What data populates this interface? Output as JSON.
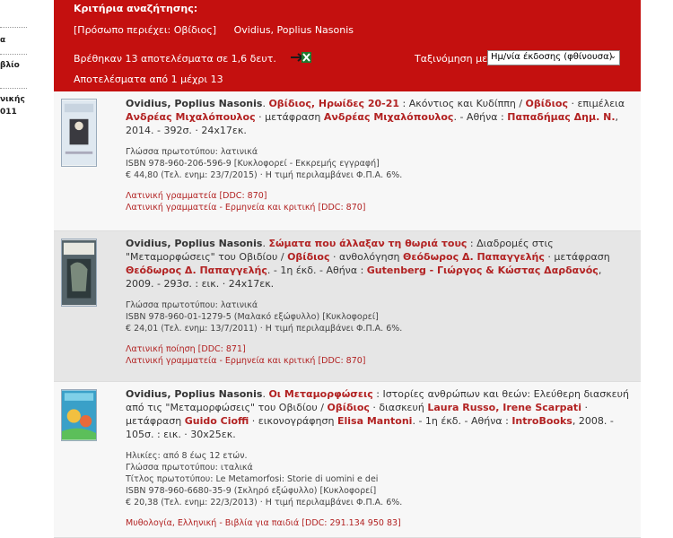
{
  "left_fragments": [
    "α",
    "βλίο",
    "νικής",
    "011"
  ],
  "header": {
    "title": "Κριτήρια αναζήτησης:",
    "criteria_person": "[Πρόσωπο περιέχει: Οβίδιος]",
    "criteria_name": "Ovidius, Poplius Nasonis",
    "found_text": "Βρέθηκαν 13 αποτελέσματα σε 1,6 δευτ.",
    "range_text": "Αποτελέσματα από 1 μέχρι 13",
    "sort_label": "Ταξινόμηση με",
    "sort_value": "Ημ/νία έκδοσης (φθίνουσα)"
  },
  "results": [
    {
      "author": "Ovidius, Poplius Nasonis",
      "title": "Οβίδιος, Ηρωίδες 20-21",
      "subtitle": " : Ακόντιος και Κυδίππη / ",
      "author2": "Οβίδιος",
      "roles": " · επιμέλεια ",
      "editor": "Ανδρέας Μιχαλόπουλος",
      "roles2": " · μετάφραση ",
      "translator": "Ανδρέας Μιχαλόπουλος",
      "place": ". - Αθήνα : ",
      "publisher": "Παπαδήμας Δημ. Ν.",
      "tail": ", 2014. - 392σ. · 24x17εκ.",
      "language": "Γλώσσα πρωτοτύπου: λατινικά",
      "isbn": "ISBN 978-960-206-596-9 [Κυκλοφορεί - Εκκρεμής εγγραφή]",
      "price": "€ 44,80 (Τελ. ενημ: 23/7/2015) · Η τιμή περιλαμβάνει Φ.Π.Α. 6%.",
      "subjects": [
        "Λατινική γραμματεία [DDC: 870]",
        "Λατινική γραμματεία - Ερμηνεία και κριτική [DDC: 870]"
      ]
    },
    {
      "author": "Ovidius, Poplius Nasonis",
      "title": "Σώματα που άλλαξαν τη θωριά τους",
      "subtitle": " : Διαδρομές στις \"Μεταμορφώσεις\" του Οβιδίου / ",
      "author2": "Οβίδιος",
      "roles": " · ανθολόγηση ",
      "editor": "Θεόδωρος Δ. Παπαγγελής",
      "roles2": " · μετάφραση ",
      "translator": "Θεόδωρος Δ. Παπαγγελής",
      "place": ". - 1η έκδ. - Αθήνα : ",
      "publisher": "Gutenberg - Γιώργος & Κώστας Δαρδανός",
      "tail": ", 2009. - 293σ. : εικ. · 24x17εκ.",
      "language": "Γλώσσα πρωτοτύπου: λατινικά",
      "isbn": "ISBN 978-960-01-1279-5 (Μαλακό εξώφυλλο) [Κυκλοφορεί]",
      "price": "€ 24,01 (Τελ. ενημ: 13/7/2011) · Η τιμή περιλαμβάνει Φ.Π.Α. 6%.",
      "subjects": [
        "Λατινική ποίηση [DDC: 871]",
        "Λατινική γραμματεία - Ερμηνεία και κριτική [DDC: 870]"
      ]
    },
    {
      "author": "Ovidius, Poplius Nasonis",
      "title": "Οι Μεταμορφώσεις",
      "subtitle": " : Ιστορίες ανθρώπων και θεών: Ελεύθερη διασκευή από τις \"Μεταμορφώσεις\" του Οβιδίου / ",
      "author2": "Οβίδιος",
      "roles": " · διασκευή ",
      "editor": "Laura Russo, Irene Scarpati",
      "roles2": " · μετάφραση ",
      "translator": "Guido Cioffi",
      "roles3": " · εικονογράφηση ",
      "illustrator": "Elisa Mantoni",
      "place": ". - 1η έκδ. - Αθήνα : ",
      "publisher": "IntroBooks",
      "tail": ", 2008. - 105σ. : εικ. · 30x25εκ.",
      "ages": "Ηλικίες: από 8 έως 12 ετών.",
      "language": "Γλώσσα πρωτοτύπου: ιταλικά",
      "orig_title": "Τίτλος πρωτοτύπου: Le Metamorfosi: Storie di uomini e dei",
      "isbn": "ISBN 978-960-6680-35-9 (Σκληρό εξώφυλλο) [Κυκλοφορεί]",
      "price": "€ 20,38 (Τελ. ενημ: 22/3/2013) · Η τιμή περιλαμβάνει Φ.Π.Α. 6%.",
      "subjects": [
        "Μυθολογία, Ελληνική - Βιβλία για παιδιά [DDC: 291.134 950 83]"
      ]
    }
  ],
  "colors": {
    "header_red": "#c4100f",
    "link_red": "#b22222"
  }
}
